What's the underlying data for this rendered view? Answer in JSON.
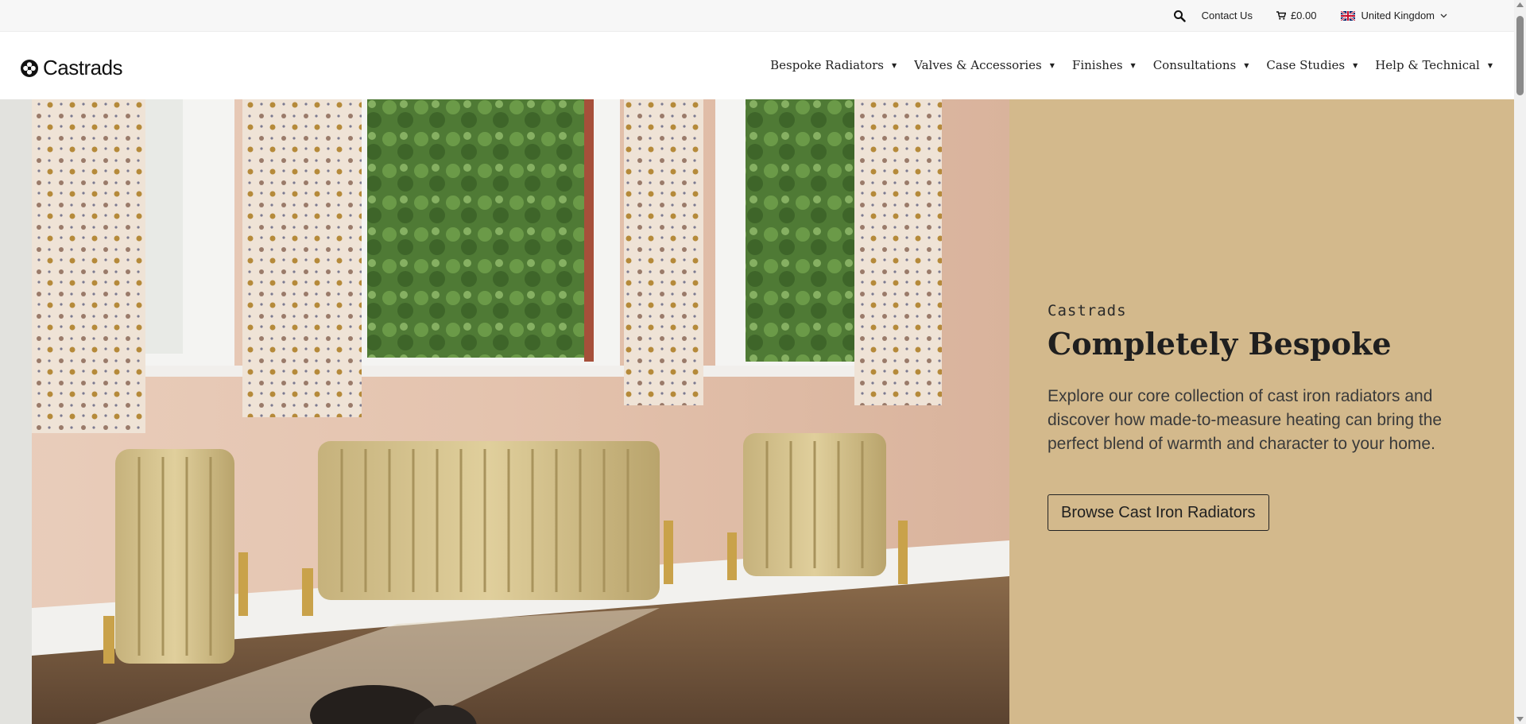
{
  "topbar": {
    "search_icon": "search-icon",
    "contact_label": "Contact Us",
    "cart_icon": "cart-icon",
    "cart_total": "£0.00",
    "region_flag": "uk-flag-icon",
    "region_label": "United Kingdom"
  },
  "header": {
    "brand": "Castrads",
    "nav": [
      {
        "label": "Bespoke Radiators"
      },
      {
        "label": "Valves & Accessories"
      },
      {
        "label": "Finishes"
      },
      {
        "label": "Consultations"
      },
      {
        "label": "Case Studies"
      },
      {
        "label": "Help & Technical"
      }
    ]
  },
  "hero": {
    "eyebrow": "Castrads",
    "headline": "Completely Bespoke",
    "description": "Explore our core collection of cast iron radiators and discover how made-to-measure heating can bring the perfect blend of warmth and character to your home.",
    "cta_label": "Browse Cast Iron Radiators",
    "panel_color": "#d3b98c"
  }
}
